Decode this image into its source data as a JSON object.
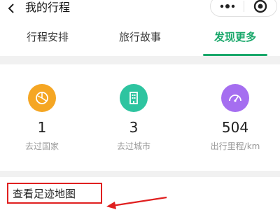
{
  "navbar": {
    "title": "我的行程",
    "back_icon": "chevron-left-icon",
    "more_icon": "more-dots-icon",
    "close_icon": "target-close-icon"
  },
  "tabs": [
    {
      "label": "行程安排",
      "active": false
    },
    {
      "label": "旅行故事",
      "active": false
    },
    {
      "label": "发现更多",
      "active": true
    }
  ],
  "stats": [
    {
      "value": "1",
      "label": "去过国家",
      "icon": "globe-icon",
      "color": "#f5a623"
    },
    {
      "value": "3",
      "label": "去过城市",
      "icon": "building-icon",
      "color": "#2ec4a0"
    },
    {
      "value": "504",
      "label": "出行里程/km",
      "icon": "speedometer-icon",
      "color": "#a56ef0"
    }
  ],
  "footprint": {
    "label": "查看足迹地图"
  },
  "colors": {
    "accent": "#1aa86b",
    "highlight": "#e02020"
  }
}
